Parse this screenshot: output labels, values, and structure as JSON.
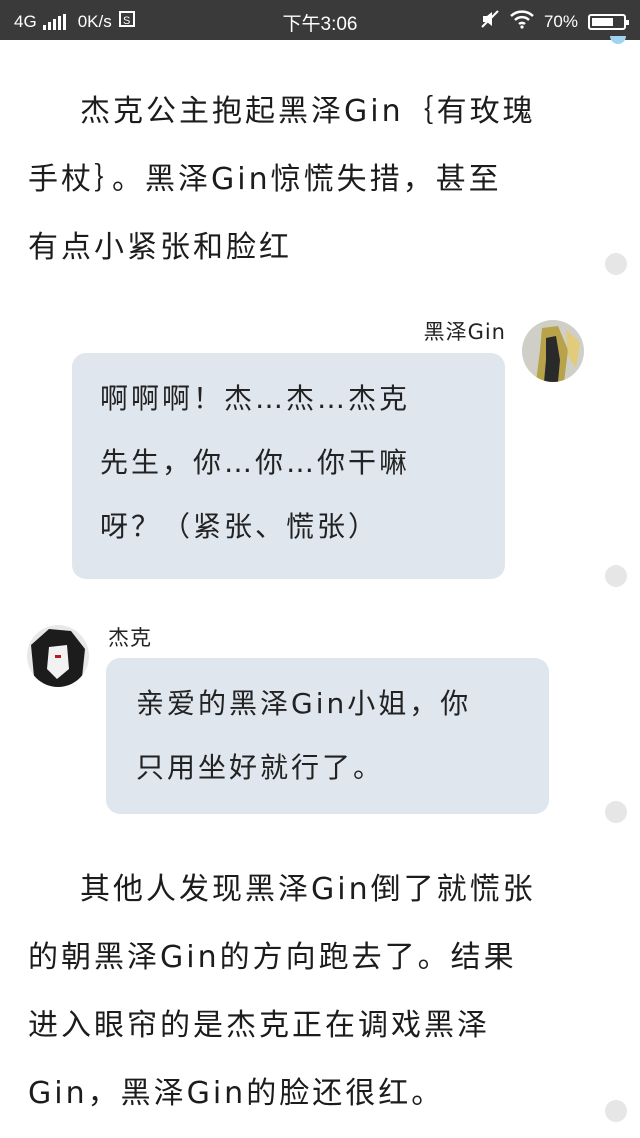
{
  "status_bar": {
    "network": "4G",
    "speed": "0K/s",
    "time": "下午3:06",
    "battery_percent": "70%",
    "battery_level": 0.7
  },
  "story": {
    "paragraph_1": [
      "杰克公主抱起黑泽Gin｛有玫瑰",
      "手杖｝。黑泽Gin惊慌失措，甚至",
      "有点小紧张和脸红"
    ],
    "message_1": {
      "sender": "黑泽Gin",
      "lines": [
        "啊啊啊！杰…杰…杰克",
        "先生，你…你…你干嘛",
        "呀？（紧张、慌张）"
      ]
    },
    "message_2": {
      "sender": "杰克",
      "lines": [
        "亲爱的黑泽Gin小姐，你",
        "只用坐好就行了。"
      ]
    },
    "paragraph_2": [
      "其他人发现黑泽Gin倒了就慌张",
      "的朝黑泽Gin的方向跑去了。结果",
      "进入眼帘的是杰克正在调戏黑泽",
      "Gin，黑泽Gin的脸还很红。"
    ]
  },
  "icons": {
    "signal": "signal-bars-icon",
    "data_saver": "data-saver-icon",
    "mute": "mute-icon",
    "wifi": "wifi-icon",
    "battery": "battery-icon"
  },
  "colors": {
    "status_bar_bg": "#3a3a3a",
    "bubble_bg": "#dfe6ee",
    "side_dot": "#e6e6e6"
  }
}
